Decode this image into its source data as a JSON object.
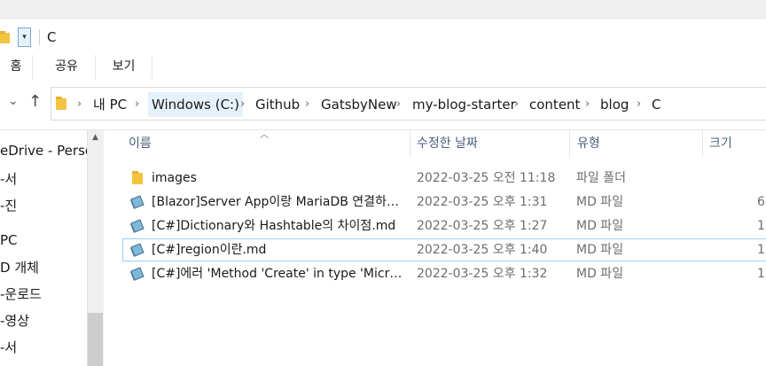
{
  "window": {
    "title": "C"
  },
  "ribbon": {
    "tabs": [
      "홈",
      "공유",
      "보기"
    ]
  },
  "address": {
    "crumbs": [
      "내 PC",
      "Windows (C:)",
      "Github",
      "GatsbyNew",
      "my-blog-starter",
      "content",
      "blog",
      "C"
    ]
  },
  "nav": {
    "items": [
      "eDrive - Persor",
      "-서",
      "-진",
      "PC",
      "D 개체",
      "-운로드",
      "-영상",
      "-서"
    ]
  },
  "columns": {
    "name": "이름",
    "date": "수정한 날짜",
    "type": "유형",
    "size": "크기"
  },
  "files": [
    {
      "name": "images",
      "date": "2022-03-25 오전 11:18",
      "type": "파일 폴더",
      "size": "",
      "icon": "folder-icon"
    },
    {
      "name": "[Blazor]Server App이랑 MariaDB 연결하…",
      "date": "2022-03-25 오후 1:31",
      "type": "MD 파일",
      "size": "6",
      "icon": "md-file-icon"
    },
    {
      "name": "[C#]Dictionary와 Hashtable의 차이점.md",
      "date": "2022-03-25 오후 1:27",
      "type": "MD 파일",
      "size": "1",
      "icon": "md-file-icon"
    },
    {
      "name": "[C#]region이란.md",
      "date": "2022-03-25 오후 1:40",
      "type": "MD 파일",
      "size": "1",
      "icon": "md-file-icon"
    },
    {
      "name": "[C#]에러 'Method 'Create' in type 'Micr…",
      "date": "2022-03-25 오후 1:32",
      "type": "MD 파일",
      "size": "1",
      "icon": "md-file-icon"
    }
  ],
  "colors": {
    "folder": "#f3c440",
    "selection_border": "#99d1ff",
    "header_text": "#4c607a"
  }
}
